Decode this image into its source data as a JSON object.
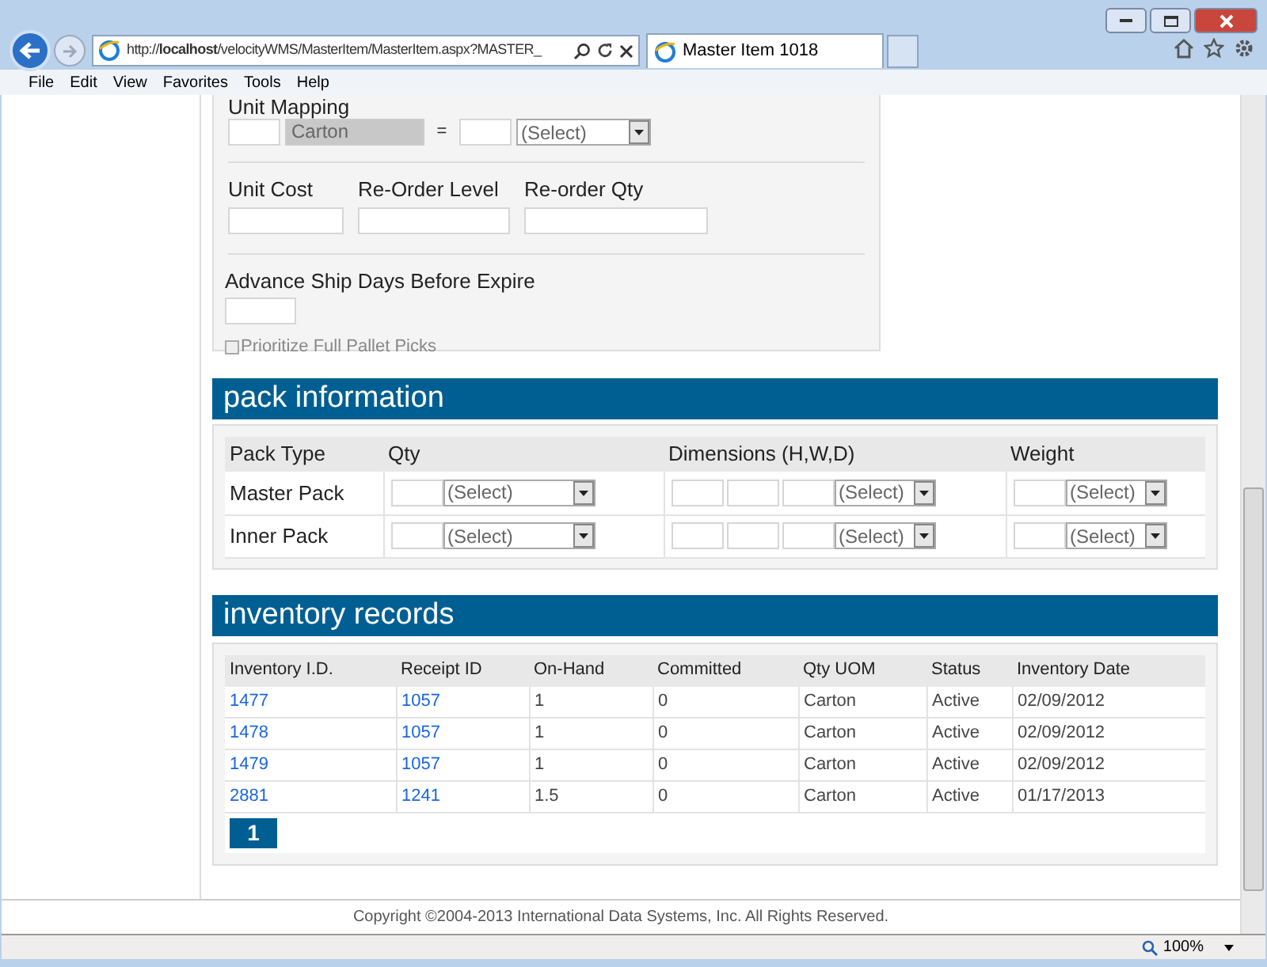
{
  "browser": {
    "address": "http://**localhost**/velocityWMS/MasterItem/MasterItem.aspx?MASTER_",
    "tab_title": "Master Item 1018",
    "menu": [
      "File",
      "Edit",
      "View",
      "Favorites",
      "Tools",
      "Help"
    ]
  },
  "item_form": {
    "unit_mapping": {
      "label": "Unit Mapping",
      "unit": "Carton",
      "equals": "=",
      "select": "(Select)"
    },
    "fields": [
      {
        "label": "Unit Cost"
      },
      {
        "label": "Re-Order Level"
      },
      {
        "label": "Re-order Qty"
      }
    ],
    "advance_ship": {
      "label": "Advance Ship Days Before Expire"
    },
    "prioritize": {
      "label": "Prioritize Full Pallet Picks",
      "checked": false,
      "disabled": true
    }
  },
  "pack_information": {
    "title": "pack information",
    "columns": [
      "Pack Type",
      "Qty",
      "Dimensions (H,W,D)",
      "Weight"
    ],
    "rows": [
      {
        "type": "Master Pack",
        "qty_select": "(Select)",
        "dim_select": "(Select)",
        "weight_select": "(Select)"
      },
      {
        "type": "Inner Pack",
        "qty_select": "(Select)",
        "dim_select": "(Select)",
        "weight_select": "(Select)"
      }
    ]
  },
  "inventory_records": {
    "title": "inventory records",
    "columns": [
      "Inventory I.D.",
      "Receipt ID",
      "On-Hand",
      "Committed",
      "Qty UOM",
      "Status",
      "Inventory Date"
    ],
    "rows": [
      [
        "1477",
        "1057",
        "1",
        "0",
        "Carton",
        "Active",
        "02/09/2012"
      ],
      [
        "1478",
        "1057",
        "1",
        "0",
        "Carton",
        "Active",
        "02/09/2012"
      ],
      [
        "1479",
        "1057",
        "1",
        "0",
        "Carton",
        "Active",
        "02/09/2012"
      ],
      [
        "2881",
        "1241",
        "1.5",
        "0",
        "Carton",
        "Active",
        "01/17/2013"
      ]
    ],
    "pages": [
      {
        "label": "1",
        "selected": true
      }
    ]
  },
  "footer": {
    "copyright": "Copyright ©2004-2013 International Data Systems, Inc. All Rights Reserved."
  },
  "status_bar": {
    "zoom": "100%"
  }
}
